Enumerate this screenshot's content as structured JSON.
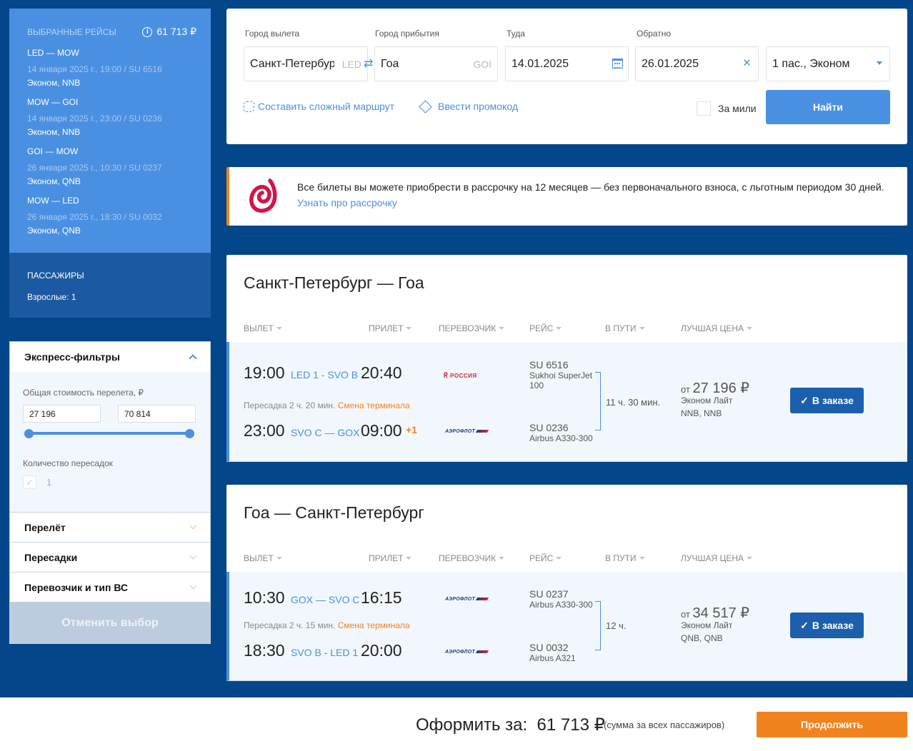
{
  "sidebar": {
    "selected_title": "Выбранные рейсы",
    "selected_total": "61 713 ₽",
    "segments": [
      {
        "route": "LED — MOW",
        "date": "14 января 2025 г., 19:00 / SU 6516",
        "class": "Эконом, NNB"
      },
      {
        "route": "MOW — GOI",
        "date": "14 января 2025 г., 23:00 / SU 0236",
        "class": "Эконом, NNB"
      },
      {
        "route": "GOI — MOW",
        "date": "26 января 2025 г., 10:30 / SU 0237",
        "class": "Эконом, QNB"
      },
      {
        "route": "MOW — LED",
        "date": "26 января 2025 г., 18:30 / SU 0032",
        "class": "Эконом, QNB"
      }
    ],
    "passengers_title": "Пассажиры",
    "passengers_count": "Взрослые: 1"
  },
  "filters": {
    "express_title": "Экспресс-фильтры",
    "price_label": "Общая стоимость перелета, ₽",
    "price_min": "27 196",
    "price_max": "70 814",
    "slider_range": [
      0,
      1
    ],
    "stops_label": "Количество пересадок",
    "stops_option": "1",
    "sections": [
      "Перелёт",
      "Пересадки",
      "Перевозчик и тип ВС"
    ],
    "cancel_label": "Отменить выбор"
  },
  "search": {
    "from_label": "Город вылета",
    "from_value": "Санкт-Петербург",
    "from_code": "LED",
    "to_label": "Город прибытия",
    "to_value": "Гоа",
    "to_code": "GOI",
    "depart_label": "Туда",
    "depart_value": "14.01.2025",
    "return_label": "Обратно",
    "return_value": "26.01.2025",
    "pax_value": "1 пас., Эконом",
    "complex_route": "Составить сложный маршрут",
    "promo": "Ввести промокод",
    "miles_label": "За мили",
    "find_label": "Найти"
  },
  "banner": {
    "text": "Все билеты вы можете приобрести в рассрочку на 12 месяцев — без первоначального взноса, с льготным периодом 30 дней.",
    "link": "Узнать про рассрочку"
  },
  "columns": [
    "Вылет",
    "Прилет",
    "Перевозчик",
    "Рейс",
    "В пути",
    "Лучшая цена"
  ],
  "outbound": {
    "title": "Санкт-Петербург — Гоа",
    "leg1": {
      "dep": "19:00",
      "route": "LED 1 - SVO B",
      "arr": "20:40",
      "carrier": "РОССИЯ",
      "flight": "SU 6516",
      "aircraft": "Sukhoi SuperJet 100"
    },
    "transfer": "Пересадка 2 ч. 20 мин.",
    "transfer_warn": "Смена терминала",
    "leg2": {
      "dep": "23:00",
      "route": "SVO C — GOX",
      "arr": "09:00",
      "plus": "+1",
      "carrier": "АЭРОФЛОТ",
      "flight": "SU 0236",
      "aircraft": "Airbus A330-300"
    },
    "duration": "11 ч. 30 мин.",
    "price_prefix": "от",
    "price": "27 196 ₽",
    "fare": "Эконом Лайт",
    "fare_codes": "NNB, NNB",
    "button": "В заказе"
  },
  "inbound": {
    "title": "Гоа — Санкт-Петербург",
    "leg1": {
      "dep": "10:30",
      "route": "GOX — SVO C",
      "arr": "16:15",
      "carrier": "АЭРОФЛОТ",
      "flight": "SU 0237",
      "aircraft": "Airbus A330-300"
    },
    "transfer": "Пересадка 2 ч. 15 мин.",
    "transfer_warn": "Смена терминала",
    "leg2": {
      "dep": "18:30",
      "route": "SVO B - LED 1",
      "arr": "20:00",
      "carrier": "АЭРОФЛОТ",
      "flight": "SU 0032",
      "aircraft": "Airbus A321"
    },
    "duration": "12 ч.",
    "price_prefix": "от",
    "price": "34 517 ₽",
    "fare": "Эконом Лайт",
    "fare_codes": "QNB, QNB",
    "button": "В заказе"
  },
  "footer": {
    "total_label": "Оформить за:",
    "total_value": "61 713 ₽",
    "note": "(сумма за всех пассажиров)",
    "continue": "Продолжить"
  },
  "colors": {
    "primary": "#4a90e2",
    "dark_bg": "#03468a",
    "accent": "#f0831e",
    "button_dark": "#1b5fad"
  }
}
